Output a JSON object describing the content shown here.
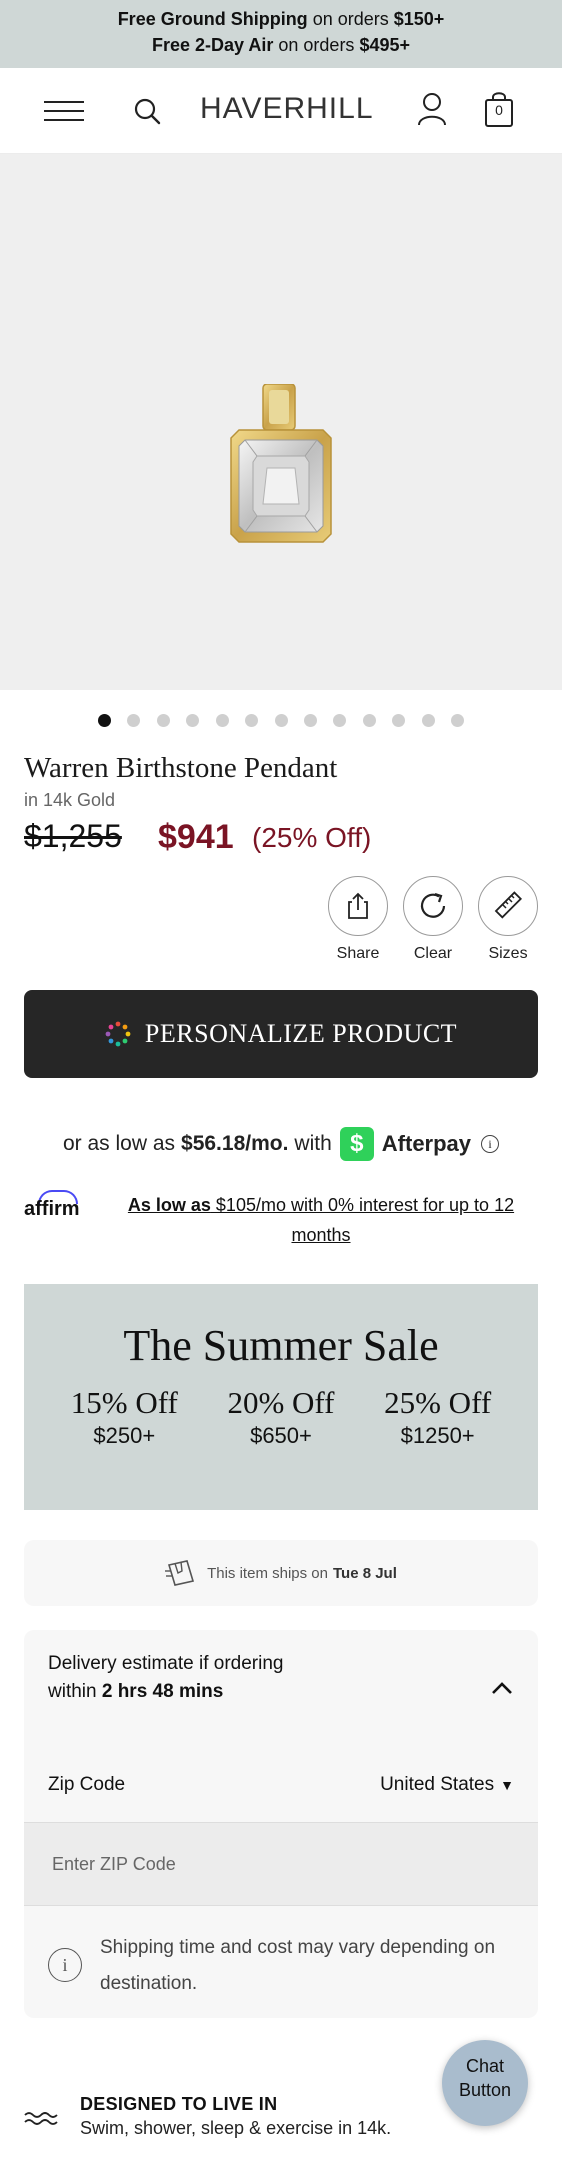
{
  "banner": {
    "line1_bold": "Free Ground Shipping",
    "line1_rest": " on orders ",
    "line1_amount": "$150+",
    "line2_bold": "Free 2-Day Air",
    "line2_rest": " on orders ",
    "line2_amount": "$495+"
  },
  "nav": {
    "logo": "HAVERHILL",
    "bag_count": "0",
    "icons": [
      "menu-icon",
      "search-icon",
      "account-icon",
      "bag-icon"
    ]
  },
  "gallery": {
    "dot_count": 13,
    "active_index": 0
  },
  "product": {
    "title": "Warren Birthstone Pendant",
    "subtitle": "in 14k Gold",
    "old_price": "$1,255",
    "new_price": "$941",
    "discount": "(25% Off)"
  },
  "actions": [
    {
      "label": "Share",
      "icon": "share-icon"
    },
    {
      "label": "Clear",
      "icon": "refresh-icon"
    },
    {
      "label": "Sizes",
      "icon": "ruler-icon"
    }
  ],
  "personalize": {
    "label": "PERSONALIZE PRODUCT"
  },
  "afterpay": {
    "prefix": "or as low as",
    "amount": "$56.18/mo.",
    "mid": "with",
    "brand": "Afterpay",
    "badge": "$"
  },
  "affirm": {
    "logo": "affirm",
    "text_bold_underline": "As low as",
    "text_rest": " $105/mo with 0% interest for up to 12 months"
  },
  "sale": {
    "title": "The Summer Sale",
    "tiers": [
      {
        "off": "15% Off",
        "min": "$250+"
      },
      {
        "off": "20% Off",
        "min": "$650+"
      },
      {
        "off": "25% Off",
        "min": "$1250+"
      }
    ]
  },
  "ships": {
    "prefix": "This item ships on",
    "date": "Tue 8 Jul"
  },
  "delivery": {
    "text_prefix": "Delivery estimate if ordering within ",
    "text_bold": "2 hrs 48 mins",
    "zip_label": "Zip Code",
    "country": "United States",
    "zip_placeholder": "Enter ZIP Code",
    "note": "Shipping time and cost may vary depending on destination."
  },
  "chat": {
    "label": "Chat Button"
  },
  "feature": {
    "title": "DESIGNED TO LIVE IN",
    "subtitle": "Swim, shower, sleep & exercise in 14k."
  },
  "colors": {
    "banner_bg": "#cfd7d6",
    "price_accent": "#7a1424",
    "personalize_bg": "#262626",
    "afterpay_green": "#2fd15a",
    "affirm_blue": "#4a4af4",
    "chat_bg": "#a9bccd"
  }
}
